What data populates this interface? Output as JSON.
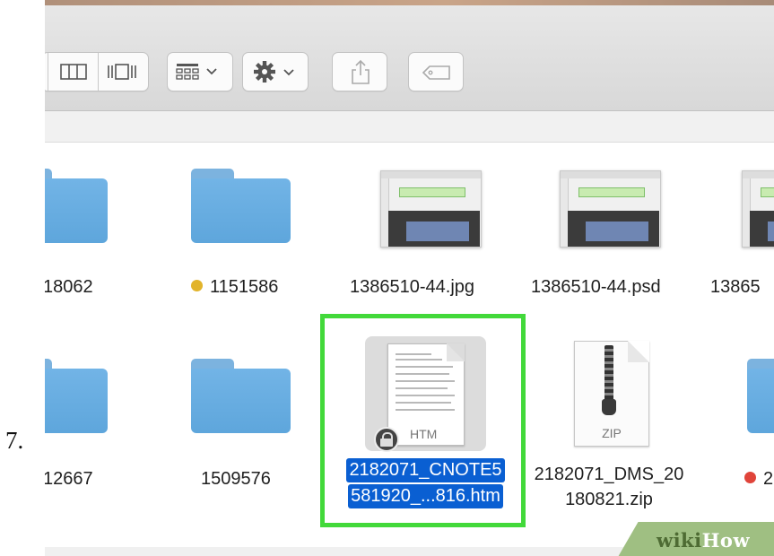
{
  "step_number": "7.",
  "files": [
    {
      "name": "18062",
      "kind": "folder",
      "tag": null
    },
    {
      "name": "1151586",
      "kind": "folder",
      "tag": "#e2b42b"
    },
    {
      "name": "1386510-44.jpg",
      "kind": "image",
      "tag": null
    },
    {
      "name": "1386510-44.psd",
      "kind": "image",
      "tag": null
    },
    {
      "name": "13865",
      "kind": "image",
      "tag": null
    },
    {
      "name": "12667",
      "kind": "folder",
      "tag": null
    },
    {
      "name": "1509576",
      "kind": "folder",
      "tag": null
    },
    {
      "name_line1": "2182071_CNOTE5",
      "name_line2": "581920_...816.htm",
      "kind": "htm",
      "icon_text": "HTM",
      "selected": true
    },
    {
      "name_line1": "2182071_DMS_20",
      "name_line2": "180821.zip",
      "kind": "zip",
      "icon_text": "ZIP"
    },
    {
      "name": "2",
      "kind": "folder",
      "tag": "#e0443a"
    }
  ],
  "watermark": {
    "part1": "wiki",
    "part2": "How"
  },
  "colors": {
    "selection_box": "#42d93a",
    "selection_label": "#0a5fd2",
    "folder": "#68ade0"
  }
}
